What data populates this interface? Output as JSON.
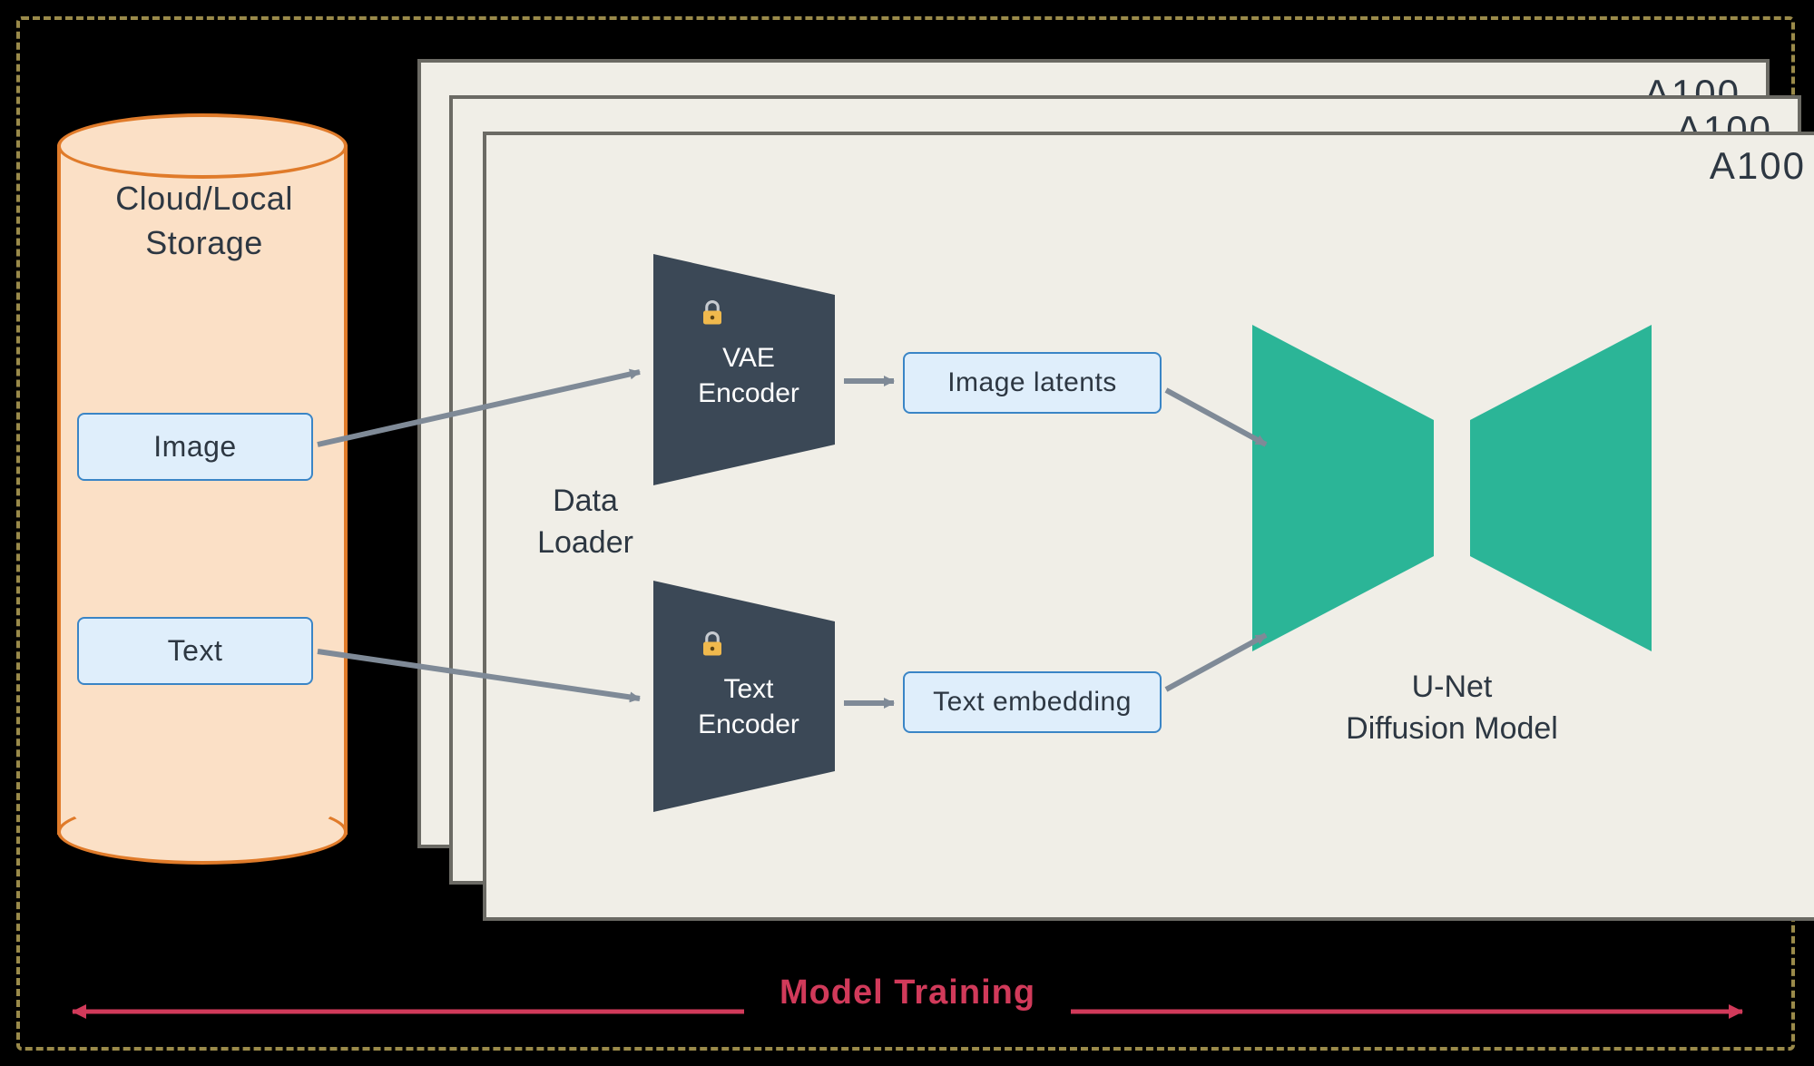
{
  "storage_title": "Cloud/Local\nStorage",
  "storage": {
    "image": "Image",
    "text": "Text"
  },
  "gpu_card_label": "A100",
  "dataloader_label": "Data\nLoader",
  "vae_encoder_label": "VAE\nEncoder",
  "text_encoder_label": "Text\nEncoder",
  "image_latents_label": "Image latents",
  "text_embedding_label": "Text embedding",
  "unet_label": "U-Net\nDiffusion Model",
  "footer_label": "Model Training",
  "colors": {
    "dash_border": "#9a8a4a",
    "cylinder_fill": "#fbe0c6",
    "cylinder_stroke": "#e07b2a",
    "blue_box_fill": "#dfeefb",
    "blue_box_stroke": "#3a85c6",
    "card_fill": "#f0eee7",
    "card_stroke": "#6b6a64",
    "encoder_fill": "#3b4856",
    "unet_fill": "#2bb597",
    "arrow": "#7f8a97",
    "footer": "#d13a5a"
  }
}
